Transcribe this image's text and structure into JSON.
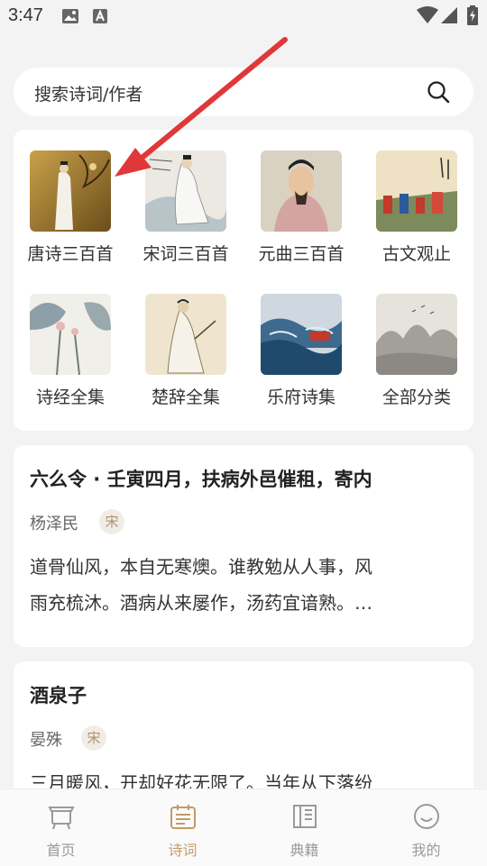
{
  "status_bar": {
    "time": "3:47"
  },
  "search": {
    "placeholder": "搜索诗词/作者"
  },
  "categories": [
    {
      "label": "唐诗三百首"
    },
    {
      "label": "宋词三百首"
    },
    {
      "label": "元曲三百首"
    },
    {
      "label": "古文观止"
    },
    {
      "label": "诗经全集"
    },
    {
      "label": "楚辞全集"
    },
    {
      "label": "乐府诗集"
    },
    {
      "label": "全部分类"
    }
  ],
  "poems": [
    {
      "title": "六么令 · 壬寅四月，扶病外邑催租，寄内",
      "author": "杨泽民",
      "dynasty": "宋",
      "line1": "道骨仙风，本自无寒燠。谁教勉从人事，风",
      "line2": "雨充梳沐。酒病从来屡作，汤药宜谙熟。…"
    },
    {
      "title": "酒泉子",
      "author": "晏殊",
      "dynasty": "宋",
      "line1": "三月暖风，开却好花无限了。当年从下落纷"
    }
  ],
  "bottom_nav": [
    {
      "label": "首页"
    },
    {
      "label": "诗词"
    },
    {
      "label": "典籍"
    },
    {
      "label": "我的"
    }
  ],
  "colors": {
    "accent": "#c49a66",
    "arrow": "#e0383a",
    "background": "#f3f3f3"
  }
}
